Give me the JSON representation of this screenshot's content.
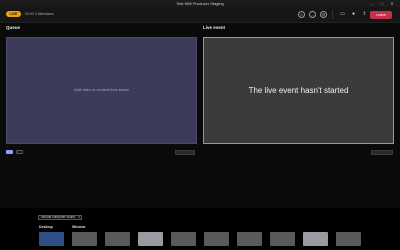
{
  "window": {
    "title": "Test MW Producer Staging"
  },
  "toolbar": {
    "status_pill": "LIVE",
    "elapsed": "00:00",
    "attendees": "0 Attendees",
    "leave_label": "Leave"
  },
  "queue": {
    "title": "Queue",
    "hint": "Add video or content from below"
  },
  "live_event": {
    "title": "Live event",
    "message": "The live event hasn't started",
    "accent_color": "#c7913b"
  },
  "sources": {
    "dropdown_value": "Include computer sound",
    "desktop_label": "Desktop",
    "window_label": "Window"
  },
  "icons": [
    "people-icon",
    "chat-icon",
    "settings-icon",
    "camera-icon",
    "mic-icon",
    "share-icon",
    "more-icon"
  ]
}
